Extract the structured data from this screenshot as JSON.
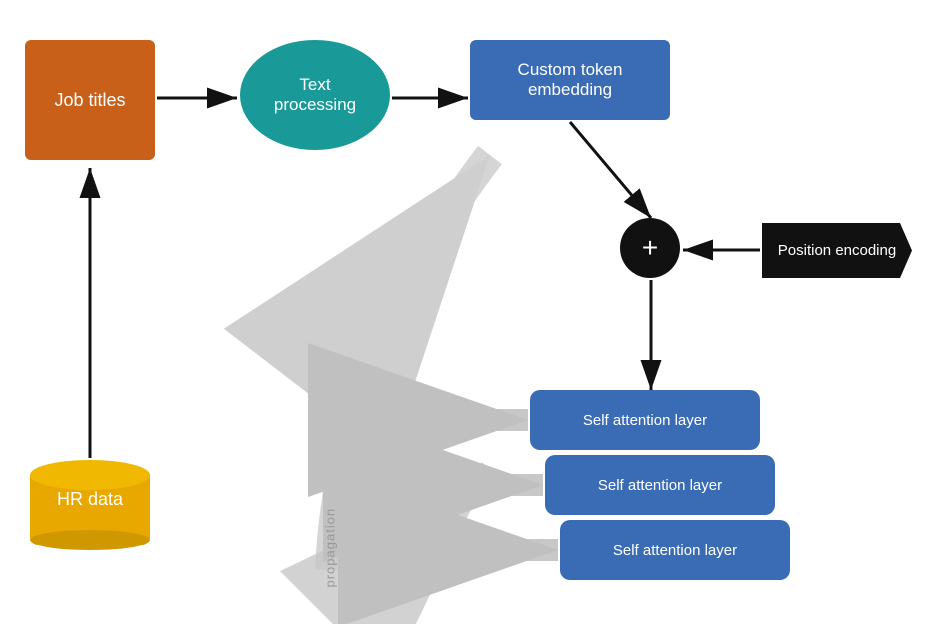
{
  "diagram": {
    "job_titles": {
      "label": "Job titles"
    },
    "hr_data": {
      "label": "HR data"
    },
    "text_processing": {
      "label": "Text processing"
    },
    "token_embedding": {
      "label": "Custom token embedding"
    },
    "plus_symbol": "+",
    "position_encoding": {
      "label": "Position encoding"
    },
    "self_attention_layers": [
      {
        "label": "Self attention layer"
      },
      {
        "label": "Self attention layer"
      },
      {
        "label": "Self attention layer"
      }
    ],
    "propagation_label": "propagation"
  },
  "colors": {
    "orange_box": "#c8601a",
    "teal_ellipse": "#1a9999",
    "blue_box": "#3a6bb5",
    "black": "#111111",
    "gold_cylinder": "#e8a800",
    "gray_arrow": "#c8c8c8",
    "white": "#ffffff"
  }
}
